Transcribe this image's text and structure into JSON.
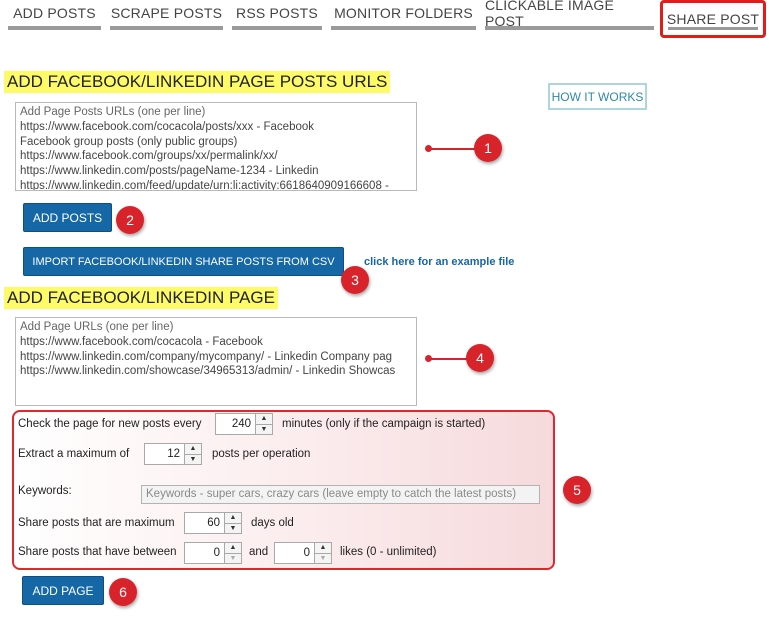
{
  "tabs": [
    {
      "label": "ADD POSTS"
    },
    {
      "label": "SCRAPE POSTS"
    },
    {
      "label": "RSS POSTS"
    },
    {
      "label": "MONITOR FOLDERS"
    },
    {
      "label": "CLICKABLE IMAGE POST"
    },
    {
      "label": "SHARE POST",
      "active": true
    }
  ],
  "posts_section": {
    "title": "ADD FACEBOOK/LINKEDIN PAGE POSTS URLS",
    "how_it_works": "HOW IT WORKS",
    "textarea_lines": [
      "Add Page Posts URLs (one per line)",
      "https://www.facebook.com/cocacola/posts/xxx - Facebook",
      "Facebook group posts (only public groups)",
      "https://www.facebook.com/groups/xx/permalink/xx/",
      "https://www.linkedin.com/posts/pageName-1234 - Linkedin",
      "https://www.linkedin.com/feed/update/urn:li:activity:6618640909166608 -"
    ],
    "add_posts_button": "ADD POSTS",
    "import_button": "IMPORT FACEBOOK/LINKEDIN SHARE POSTS FROM CSV",
    "example_link": "click here for an example file"
  },
  "page_section": {
    "title": "ADD FACEBOOK/LINKEDIN PAGE",
    "textarea_lines": [
      "Add Page URLs (one per line)",
      "https://www.facebook.com/cocacola - Facebook",
      "https://www.linkedin.com/company/mycompany/ - Linkedin Company pag",
      "https://www.linkedin.com/showcase/34965313/admin/ - Linkedin Showcas"
    ],
    "check_label": "Check the page for new posts every",
    "check_value": "240",
    "check_suffix": "minutes (only if the campaign is started)",
    "extract_label": "Extract a maximum of",
    "extract_value": "12",
    "extract_suffix": "posts per operation",
    "keywords_label": "Keywords:",
    "keywords_placeholder": "Keywords - super cars, crazy cars  (leave empty to catch the latest posts)",
    "age_label": "Share posts that are maximum",
    "age_value": "60",
    "age_suffix": "days old",
    "likes_label": "Share posts that have between",
    "likes_min": "0",
    "likes_and": "and",
    "likes_max": "0",
    "likes_suffix": "likes (0 - unlimited)",
    "add_page_button": "ADD PAGE"
  },
  "callouts": [
    "1",
    "2",
    "3",
    "4",
    "5",
    "6"
  ],
  "icons": {
    "spin_up": "arrow-up-icon",
    "spin_down": "arrow-down-icon"
  },
  "colors": {
    "accent": "#1567a5",
    "callout": "#d9232b",
    "highlight": "#fdfb67"
  }
}
